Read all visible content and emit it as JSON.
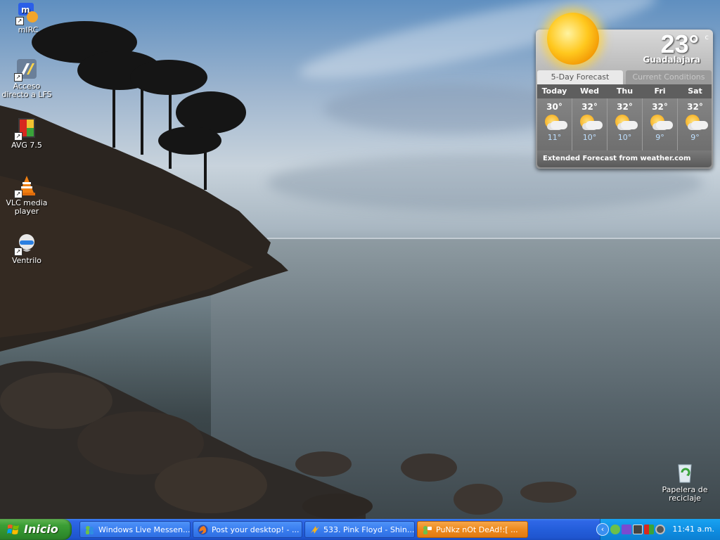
{
  "desktop": {
    "icons": [
      {
        "label": "mIRC",
        "icon": "mirc-icon"
      },
      {
        "label": "Acceso directo a LFS",
        "icon": "lfs-icon"
      },
      {
        "label": "AVG 7.5",
        "icon": "avg-icon"
      },
      {
        "label": "VLC media player",
        "icon": "vlc-icon"
      },
      {
        "label": "Ventrilo",
        "icon": "ventrilo-icon"
      }
    ],
    "recycle_bin": {
      "label": "Papelera de reciclaje",
      "icon": "recycle-bin-icon"
    }
  },
  "weather": {
    "temperature": "23°",
    "unit": "c",
    "city": "Guadalajara",
    "tabs": {
      "forecast": "5-Day Forecast",
      "current": "Current Conditions"
    },
    "days": [
      {
        "name": "Today",
        "high": "30°",
        "low": "11°",
        "icon": "partly-cloudy-icon"
      },
      {
        "name": "Wed",
        "high": "32°",
        "low": "10°",
        "icon": "partly-cloudy-icon"
      },
      {
        "name": "Thu",
        "high": "32°",
        "low": "10°",
        "icon": "partly-cloudy-icon"
      },
      {
        "name": "Fri",
        "high": "32°",
        "low": "9°",
        "icon": "partly-cloudy-icon"
      },
      {
        "name": "Sat",
        "high": "32°",
        "low": "9°",
        "icon": "partly-cloudy-icon"
      }
    ],
    "footer": "Extended Forecast from weather.com"
  },
  "taskbar": {
    "start_label": "Inicio",
    "tasks": [
      {
        "label": "Windows Live Messen...",
        "icon": "messenger-icon",
        "active": false
      },
      {
        "label": "Post your desktop! - ...",
        "icon": "firefox-icon",
        "active": false
      },
      {
        "label": "533. Pink Floyd - Shin...",
        "icon": "winamp-icon",
        "active": false
      },
      {
        "label": "PuNkz nOt DeAd!:[    ...",
        "icon": "messenger-chat-icon",
        "active": true
      }
    ],
    "clock": "11:41 a.m.",
    "colors": {
      "taskbar": "#245edb",
      "start": "#3c9e35",
      "active_task": "#ee8a1e",
      "tray": "#0f8fe3"
    }
  }
}
